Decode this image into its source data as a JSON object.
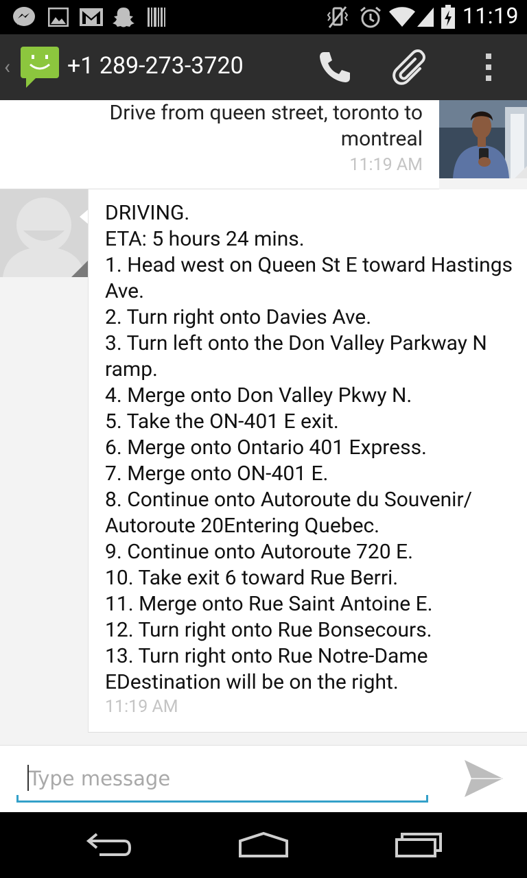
{
  "status_bar": {
    "time": "11:19",
    "left_icons": [
      "messenger-icon",
      "gallery-icon",
      "gmail-icon",
      "snapchat-icon",
      "barcode-icon"
    ],
    "right_icons": [
      "vibrate-icon",
      "alarm-icon",
      "wifi-icon",
      "signal-icon",
      "battery-charging-icon"
    ]
  },
  "action_bar": {
    "title": "+1 289-273-3720",
    "icons": [
      "call-icon",
      "attach-icon",
      "overflow-menu-icon"
    ]
  },
  "conversation": {
    "messages": [
      {
        "direction": "outgoing",
        "text": "Drive from queen street, toronto to montreal",
        "time": "11:19 AM"
      },
      {
        "direction": "incoming",
        "text": "DRIVING.\nETA: 5 hours 24 mins.\n1. Head west on Queen St E toward Hastings Ave.\n2. Turn right onto Davies Ave.\n3. Turn left onto the Don Valley Parkway N ramp.\n4. Merge onto Don Valley Pkwy N.\n5. Take the ON-401 E exit.\n6. Merge onto Ontario 401 Express.\n7. Merge onto ON-401 E.\n8. Continue onto Autoroute du Souvenir/ Autoroute 20Entering Quebec.\n9. Continue onto Autoroute 720 E.\n10. Take exit 6 toward Rue Berri.\n11. Merge onto Rue Saint Antoine E.\n12. Turn right onto Rue Bonsecours.\n13. Turn right onto Rue Notre-Dame EDestination will be on the right.",
        "time": "11:19 AM"
      }
    ]
  },
  "composer": {
    "placeholder": "Type message",
    "value": "",
    "accent_color": "#33a0c9"
  },
  "nav_bar": {
    "icons": [
      "back-icon",
      "home-icon",
      "recents-icon"
    ]
  },
  "colors": {
    "action_bar_bg": "#2d2d2d",
    "app_icon_green": "#8cc63e",
    "timestamp": "#c4c4c4"
  }
}
